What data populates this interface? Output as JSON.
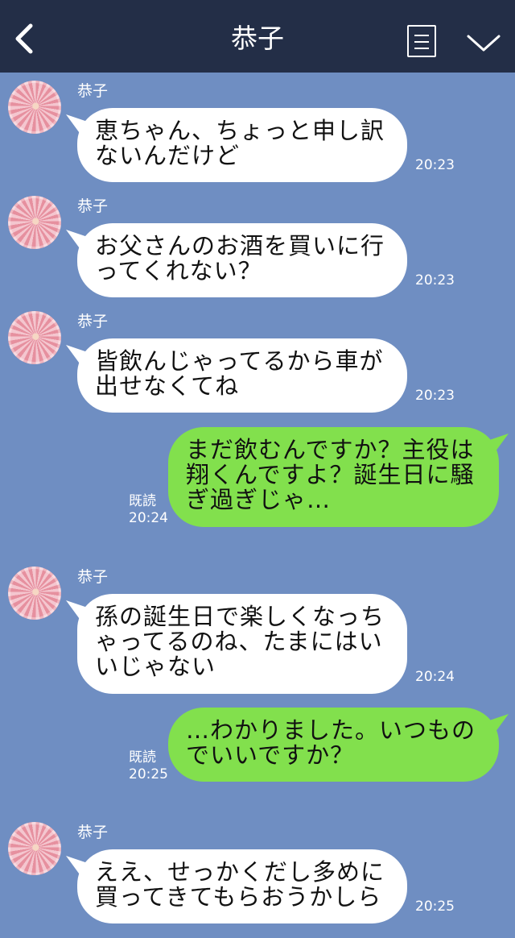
{
  "header": {
    "title": "恭子",
    "back_icon": "chevron-left-icon",
    "menu_icon": "menu-icon",
    "dropdown_icon": "chevron-down-icon"
  },
  "colors": {
    "header_bg": "#232e47",
    "chat_bg": "#6f8ec2",
    "incoming_bubble": "#ffffff",
    "outgoing_bubble": "#82e04d"
  },
  "messages": [
    {
      "direction": "in",
      "sender": "恭子",
      "text": "恵ちゃん、ちょっと申し訳\nないんだけど",
      "time": "20:23"
    },
    {
      "direction": "in",
      "sender": "恭子",
      "text": "お父さんのお酒を買いに行\nってくれない？",
      "time": "20:23"
    },
    {
      "direction": "in",
      "sender": "恭子",
      "text": "皆飲んじゃってるから車が\n出せなくてね",
      "time": "20:23"
    },
    {
      "direction": "out",
      "read_label": "既読",
      "text": "まだ飲むんですか？主役は\n翔くんですよ？誕生日に騒\nぎ過ぎじゃ…",
      "time": "20:24"
    },
    {
      "direction": "in",
      "sender": "恭子",
      "text": "孫の誕生日で楽しくなっち\nゃってるのね、たまにはい\nいじゃない",
      "time": "20:24"
    },
    {
      "direction": "out",
      "read_label": "既読",
      "text": "…わかりました。いつもの\nでいいですか？",
      "time": "20:25"
    },
    {
      "direction": "in",
      "sender": "恭子",
      "text": "ええ、せっかくだし多めに\n買ってきてもらおうかしら",
      "time": "20:25"
    }
  ]
}
